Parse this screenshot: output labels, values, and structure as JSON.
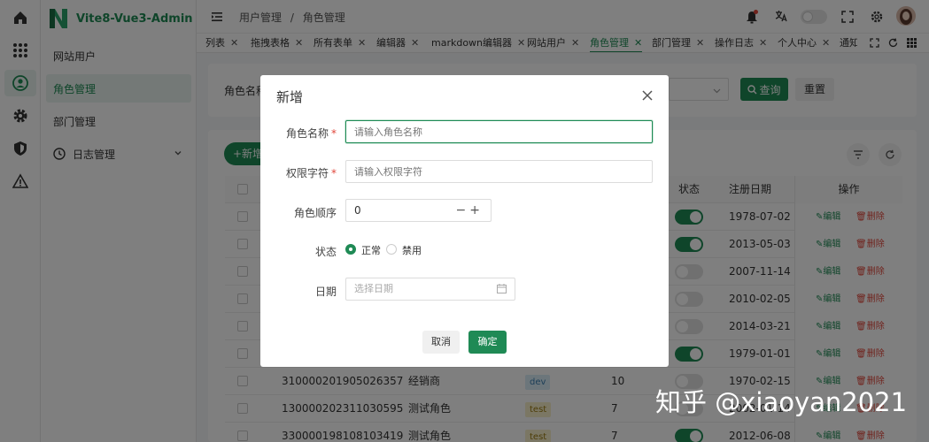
{
  "app": {
    "title": "Vite8-Vue3-Admin"
  },
  "sidebar": {
    "items": [
      {
        "label": "网站用户"
      },
      {
        "label": "角色管理"
      },
      {
        "label": "部门管理"
      },
      {
        "label": "日志管理"
      }
    ]
  },
  "breadcrumb": {
    "first": "用户管理",
    "separator": "/",
    "second": "角色管理"
  },
  "tabs": [
    {
      "label": "列表"
    },
    {
      "label": "拖拽表格"
    },
    {
      "label": "所有表单"
    },
    {
      "label": "编辑器"
    },
    {
      "label": "markdown编辑器"
    },
    {
      "label": "网站用户"
    },
    {
      "label": "角色管理"
    },
    {
      "label": "部门管理"
    },
    {
      "label": "操作日志"
    },
    {
      "label": "个人中心"
    },
    {
      "label": "通知"
    }
  ],
  "search": {
    "label": "角色名称",
    "query_btn": "查询",
    "reset_btn": "重置"
  },
  "toolbar": {
    "add_btn": "+新增"
  },
  "table": {
    "headers": {
      "status": "状态",
      "date": "注册日期",
      "ops": "操作"
    },
    "edit_label": "编辑",
    "delete_label": "删除",
    "rows": [
      {
        "id": "",
        "name": "",
        "tag": "",
        "order": "",
        "status_on": true,
        "date": "1978-07-02 19"
      },
      {
        "id": "",
        "name": "",
        "tag": "",
        "order": "",
        "status_on": true,
        "date": "2013-05-03 02"
      },
      {
        "id": "",
        "name": "",
        "tag": "",
        "order": "",
        "status_on": false,
        "date": "2007-11-14 01"
      },
      {
        "id": "",
        "name": "",
        "tag": "",
        "order": "",
        "status_on": false,
        "date": "2010-02-05 07"
      },
      {
        "id": "",
        "name": "",
        "tag": "",
        "order": "",
        "status_on": false,
        "date": "2014-03-21 13"
      },
      {
        "id": "",
        "name": "",
        "tag": "",
        "order": "",
        "status_on": true,
        "date": "1979-01-01 16"
      },
      {
        "id": "310000201905026357",
        "name": "经销商",
        "tag": "dev",
        "order": "10",
        "status_on": false,
        "date": "1970-02-15 18"
      },
      {
        "id": "130000202311030595",
        "name": "测试角色",
        "tag": "test",
        "order": "7",
        "status_on": false,
        "date": "2002-01-14 07"
      },
      {
        "id": "330000198108103419",
        "name": "测试角色",
        "tag": "test",
        "order": "7",
        "status_on": true,
        "date": "2012-06-08 12"
      }
    ]
  },
  "modal": {
    "title": "新增",
    "fields": {
      "name_label": "角色名称",
      "name_placeholder": "请输入角色名称",
      "perm_label": "权限字符",
      "perm_placeholder": "请输入权限字符",
      "order_label": "角色顺序",
      "order_value": "0",
      "status_label": "状态",
      "status_normal": "正常",
      "status_disabled": "禁用",
      "date_label": "日期",
      "date_placeholder": "选择日期"
    },
    "cancel": "取消",
    "confirm": "确定"
  },
  "watermark": "知乎 @xiaoyan2021",
  "colors": {
    "primary": "#1f8a55",
    "danger": "#e0463a",
    "dev_tag_bg": "#d9ecf7",
    "test_tag_bg": "#f7efc9"
  }
}
